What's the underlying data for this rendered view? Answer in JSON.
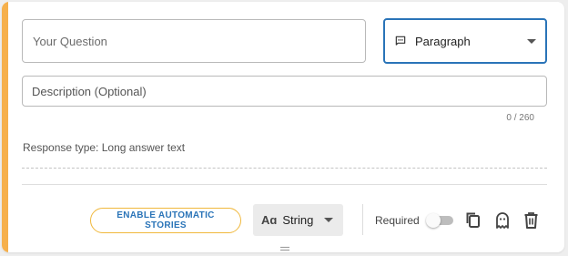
{
  "question": {
    "placeholder": "Your Question"
  },
  "type_select": {
    "icon": "chat-bubble-icon",
    "value": "Paragraph"
  },
  "description": {
    "placeholder": "Description (Optional)",
    "char_count": "0 / 260"
  },
  "response_type_text": "Response type: Long answer text",
  "footer": {
    "stories_button_label": "ENABLE AUTOMATIC STORIES",
    "data_type": {
      "icon_text": "Aɑ",
      "value": "String"
    },
    "required_label": "Required",
    "required_on": false,
    "actions": [
      "copy-icon",
      "ghost-icon",
      "trash-icon"
    ]
  },
  "colors": {
    "accent": "#f6b04c",
    "primary": "#2a74b8",
    "stories_border": "#f0b83c"
  }
}
